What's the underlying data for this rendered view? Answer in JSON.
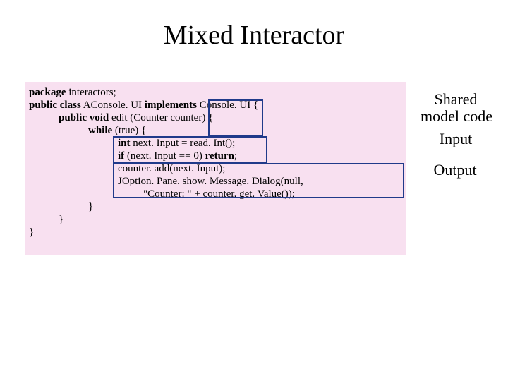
{
  "title": "Mixed Interactor",
  "code": {
    "l1a": "package",
    "l1b": " interactors;",
    "l2a": "public class",
    "l2b": " AConsole. UI ",
    "l2c": "implements",
    "l2d": " Console. UI {",
    "l3a": "public void",
    "l3b": " edit (Counter counter) {",
    "l4a": "while",
    "l4b": " (true) {",
    "l5a": "int",
    "l5b": " next. Input = read. Int();",
    "l6a": "if",
    "l6b": " (next. Input == 0) ",
    "l6c": "return",
    "l6d": ";",
    "l7": "counter. add(next. Input);",
    "l8": "JOption. Pane. show. Message. Dialog(null,",
    "l9": "\"Counter: \" + counter. get. Value());",
    "l10": "}",
    "l11": "}",
    "l12": "}"
  },
  "annot": {
    "shared1": "Shared",
    "shared2": "model code",
    "input": "Input",
    "output": "Output"
  }
}
